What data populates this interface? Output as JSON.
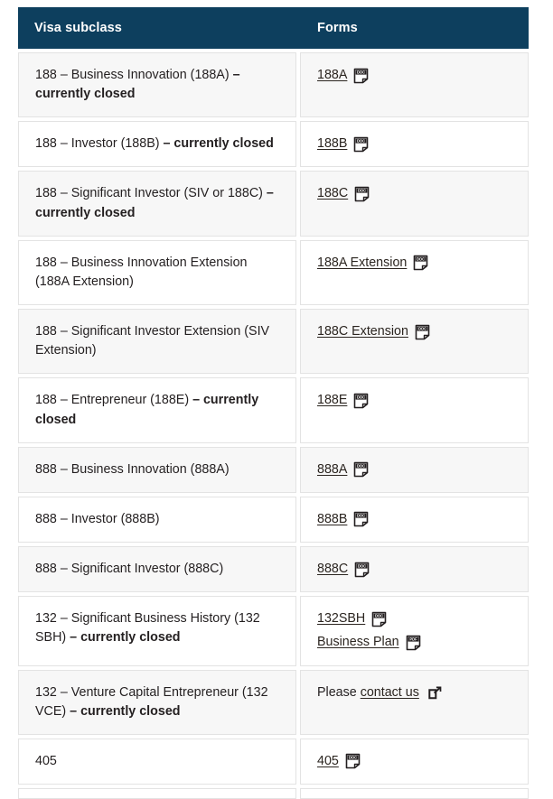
{
  "table": {
    "columns": [
      {
        "label": "Visa subclass"
      },
      {
        "label": "Forms"
      }
    ],
    "rows": [
      {
        "subclass_plain": "188 – Business Innovation (188A) ",
        "subclass_bold": "– currently closed",
        "forms": [
          {
            "label": "188A",
            "icon": "doc-icon"
          }
        ]
      },
      {
        "subclass_plain": "188 – Investor (188B) ",
        "subclass_bold": "– currently closed",
        "forms": [
          {
            "label": "188B",
            "icon": "doc-icon"
          }
        ]
      },
      {
        "subclass_plain": "188 – Significant Investor (SIV or 188C) ",
        "subclass_bold": "– currently closed",
        "forms": [
          {
            "label": "188C",
            "icon": "doc-icon"
          }
        ]
      },
      {
        "subclass_plain": "188 – Business Innovation Extension (188A Extension)",
        "subclass_bold": "",
        "forms": [
          {
            "label": "188A Extension",
            "icon": "doc-icon"
          }
        ]
      },
      {
        "subclass_plain": "188 – Significant Investor Extension (SIV Extension)",
        "subclass_bold": "",
        "forms": [
          {
            "label": "188C Extension",
            "icon": "doc-icon"
          }
        ]
      },
      {
        "subclass_plain": "188 – Entrepreneur (188E) ",
        "subclass_bold": "– currently closed",
        "forms": [
          {
            "label": "188E",
            "icon": "doc-icon"
          }
        ]
      },
      {
        "subclass_plain": "888 – Business Innovation (888A)",
        "subclass_bold": "",
        "forms": [
          {
            "label": "888A",
            "icon": "doc-icon"
          }
        ]
      },
      {
        "subclass_plain": "888 – Investor (888B)",
        "subclass_bold": "",
        "forms": [
          {
            "label": "888B",
            "icon": "doc-icon"
          }
        ]
      },
      {
        "subclass_plain": "888 – Significant Investor (888C)",
        "subclass_bold": "",
        "forms": [
          {
            "label": "888C",
            "icon": "doc-icon"
          }
        ]
      },
      {
        "subclass_plain": "132 – Significant Business History (132 SBH) ",
        "subclass_bold": "– currently closed",
        "forms": [
          {
            "label": "132SBH",
            "icon": "doc-icon"
          },
          {
            "label": "Business Plan",
            "icon": "pdf-icon"
          }
        ]
      },
      {
        "subclass_plain": "132 – Venture Capital Entrepreneur (132 VCE) ",
        "subclass_bold": "– currently closed",
        "forms": [
          {
            "prefix": "Please ",
            "label": "contact us",
            "icon": "external-link-icon"
          }
        ]
      },
      {
        "subclass_plain": "405",
        "subclass_bold": "",
        "forms": [
          {
            "label": "405",
            "icon": "doc-icon"
          }
        ]
      }
    ]
  },
  "colors": {
    "header_background": "#0d3f5e",
    "header_text": "#ffffff",
    "row_shaded": "#f7f7f7",
    "row_plain": "#ffffff",
    "cell_border": "#e3e3e3",
    "body_text": "#231f20",
    "link_text": "#2b2520"
  }
}
